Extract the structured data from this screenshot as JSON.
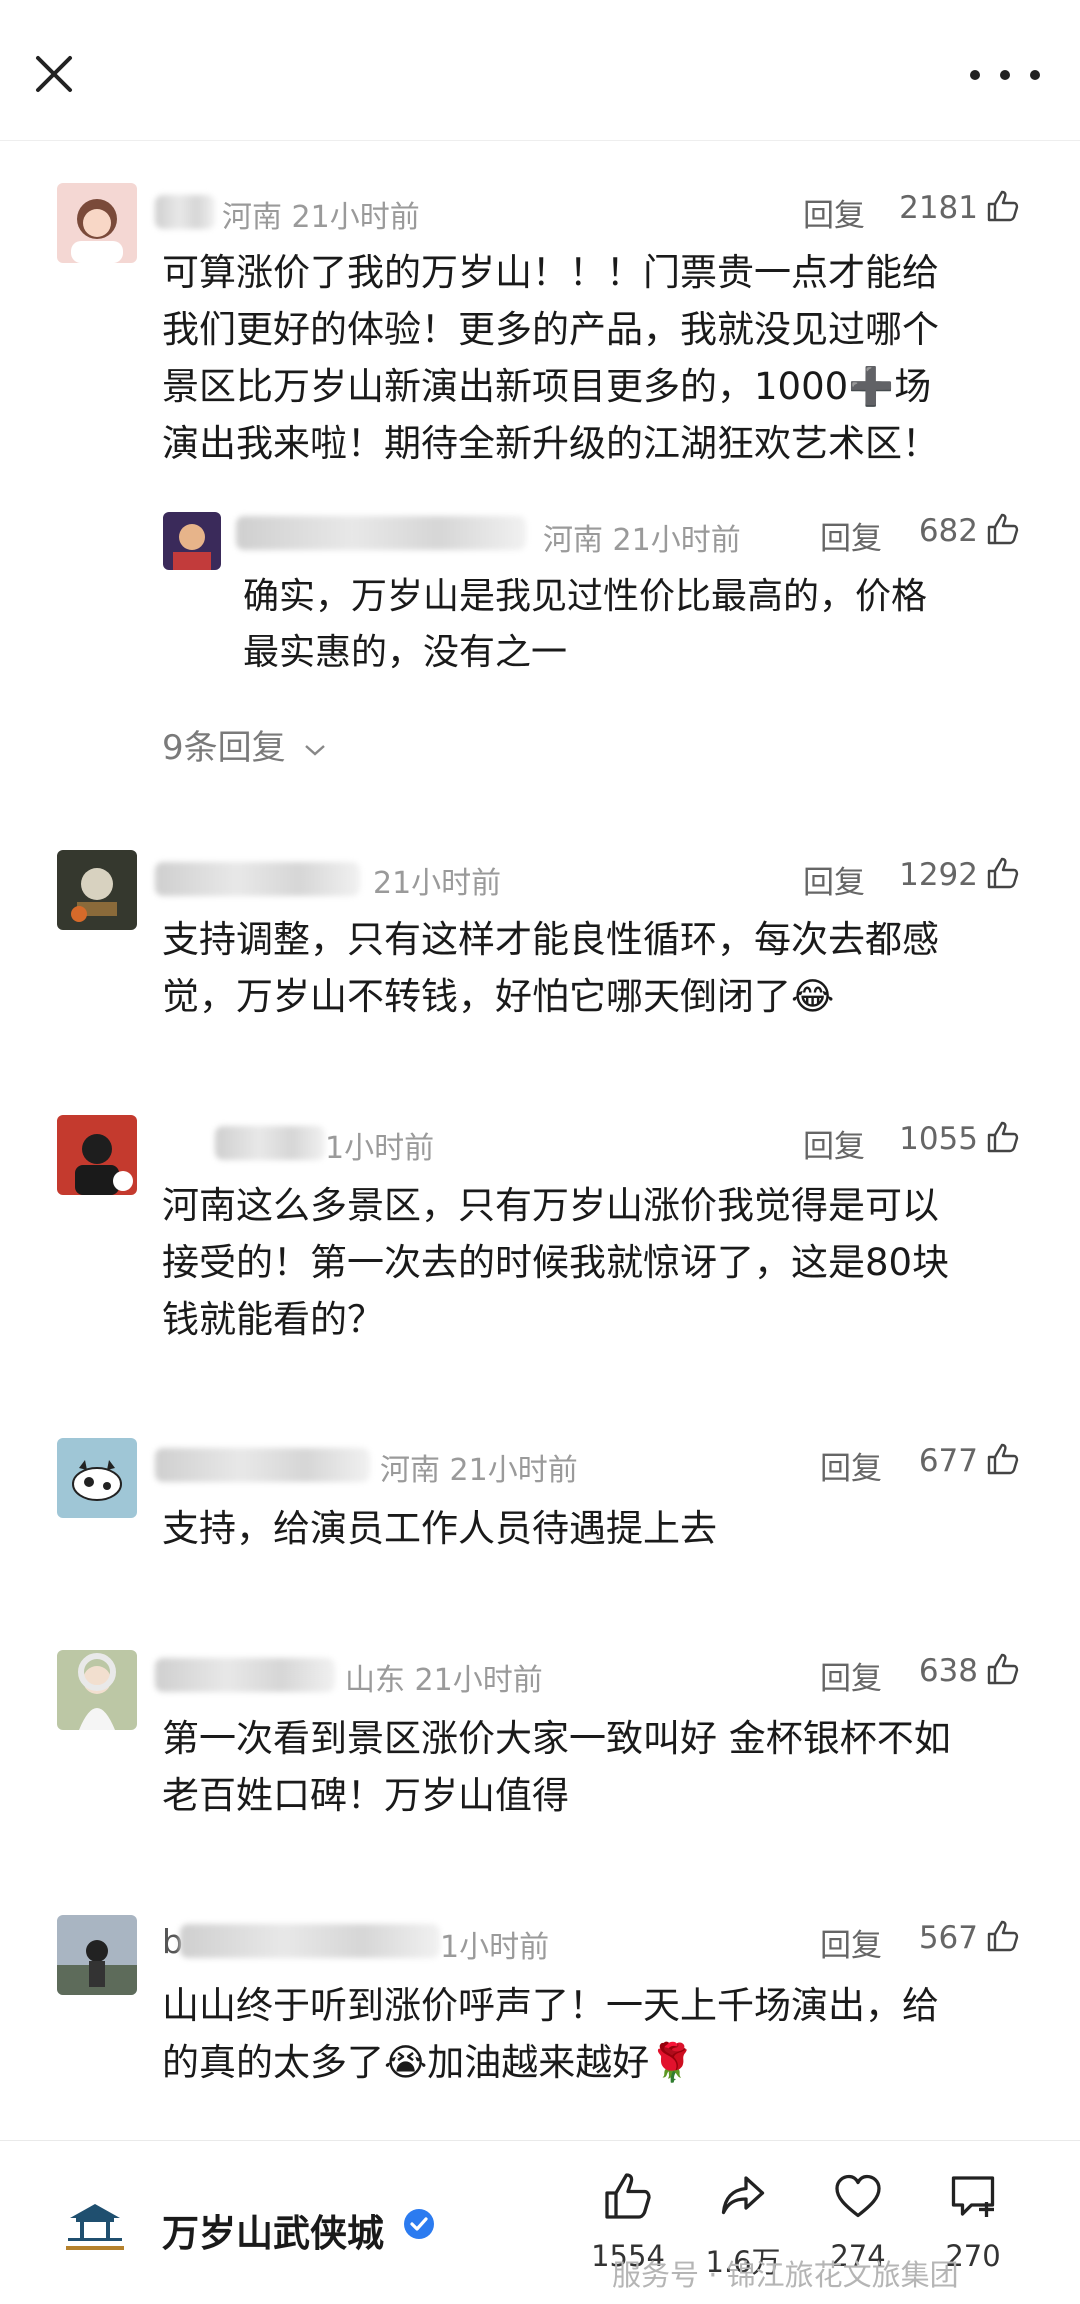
{
  "comments": [
    {
      "location": "河南",
      "time": "21小时前",
      "reply_label": "回复",
      "likes": "2181",
      "text_lines": [
        "可算涨价了我的万岁山！！！门票贵一点才能给",
        "我们更好的体验！更多的产品，我就没见过哪个",
        "景区比万岁山新演出新项目更多的，1000➕场",
        "演出我来啦！期待全新升级的江湖狂欢艺术区！"
      ],
      "sub_reply": {
        "location": "河南",
        "time": "21小时前",
        "reply_label": "回复",
        "likes": "682",
        "text_lines": [
          "确实，万岁山是我见过性价比最高的，价格",
          "最实惠的，没有之一"
        ]
      },
      "more_replies": "9条回复"
    },
    {
      "time": "21小时前",
      "reply_label": "回复",
      "likes": "1292",
      "text_lines": [
        "支持调整，只有这样才能良性循环，每次去都感",
        "觉，万岁山不转钱，好怕它哪天倒闭了😂"
      ]
    },
    {
      "time": "1小时前",
      "reply_label": "回复",
      "likes": "1055",
      "text_lines": [
        "河南这么多景区，只有万岁山涨价我觉得是可以",
        "接受的！第一次去的时候我就惊讶了，这是80块",
        "钱就能看的？"
      ]
    },
    {
      "location": "河南",
      "time": "21小时前",
      "reply_label": "回复",
      "likes": "677",
      "text_lines": [
        "支持，给演员工作人员待遇提上去"
      ]
    },
    {
      "location": "山东",
      "time": "21小时前",
      "reply_label": "回复",
      "likes": "638",
      "text_lines": [
        "第一次看到景区涨价大家一致叫好 金杯银杯不如",
        "老百姓口碑！万岁山值得"
      ]
    },
    {
      "name_prefix": "b",
      "time": "1小时前",
      "reply_label": "回复",
      "likes": "567",
      "text_lines": [
        "山山终于听到涨价呼声了！一天上千场演出，给",
        "的真的太多了😭加油越来越好🌹"
      ]
    }
  ],
  "bottom_bar": {
    "account_name": "万岁山武侠城",
    "like_count": "1554",
    "share_count": "1.6万",
    "favorite_count": "274",
    "comment_count": "270"
  },
  "watermark": "服务号 · 锦江旅花文旅集团",
  "colors": {
    "verified": "#2b7bf0",
    "meta": "#9a9a9a"
  }
}
